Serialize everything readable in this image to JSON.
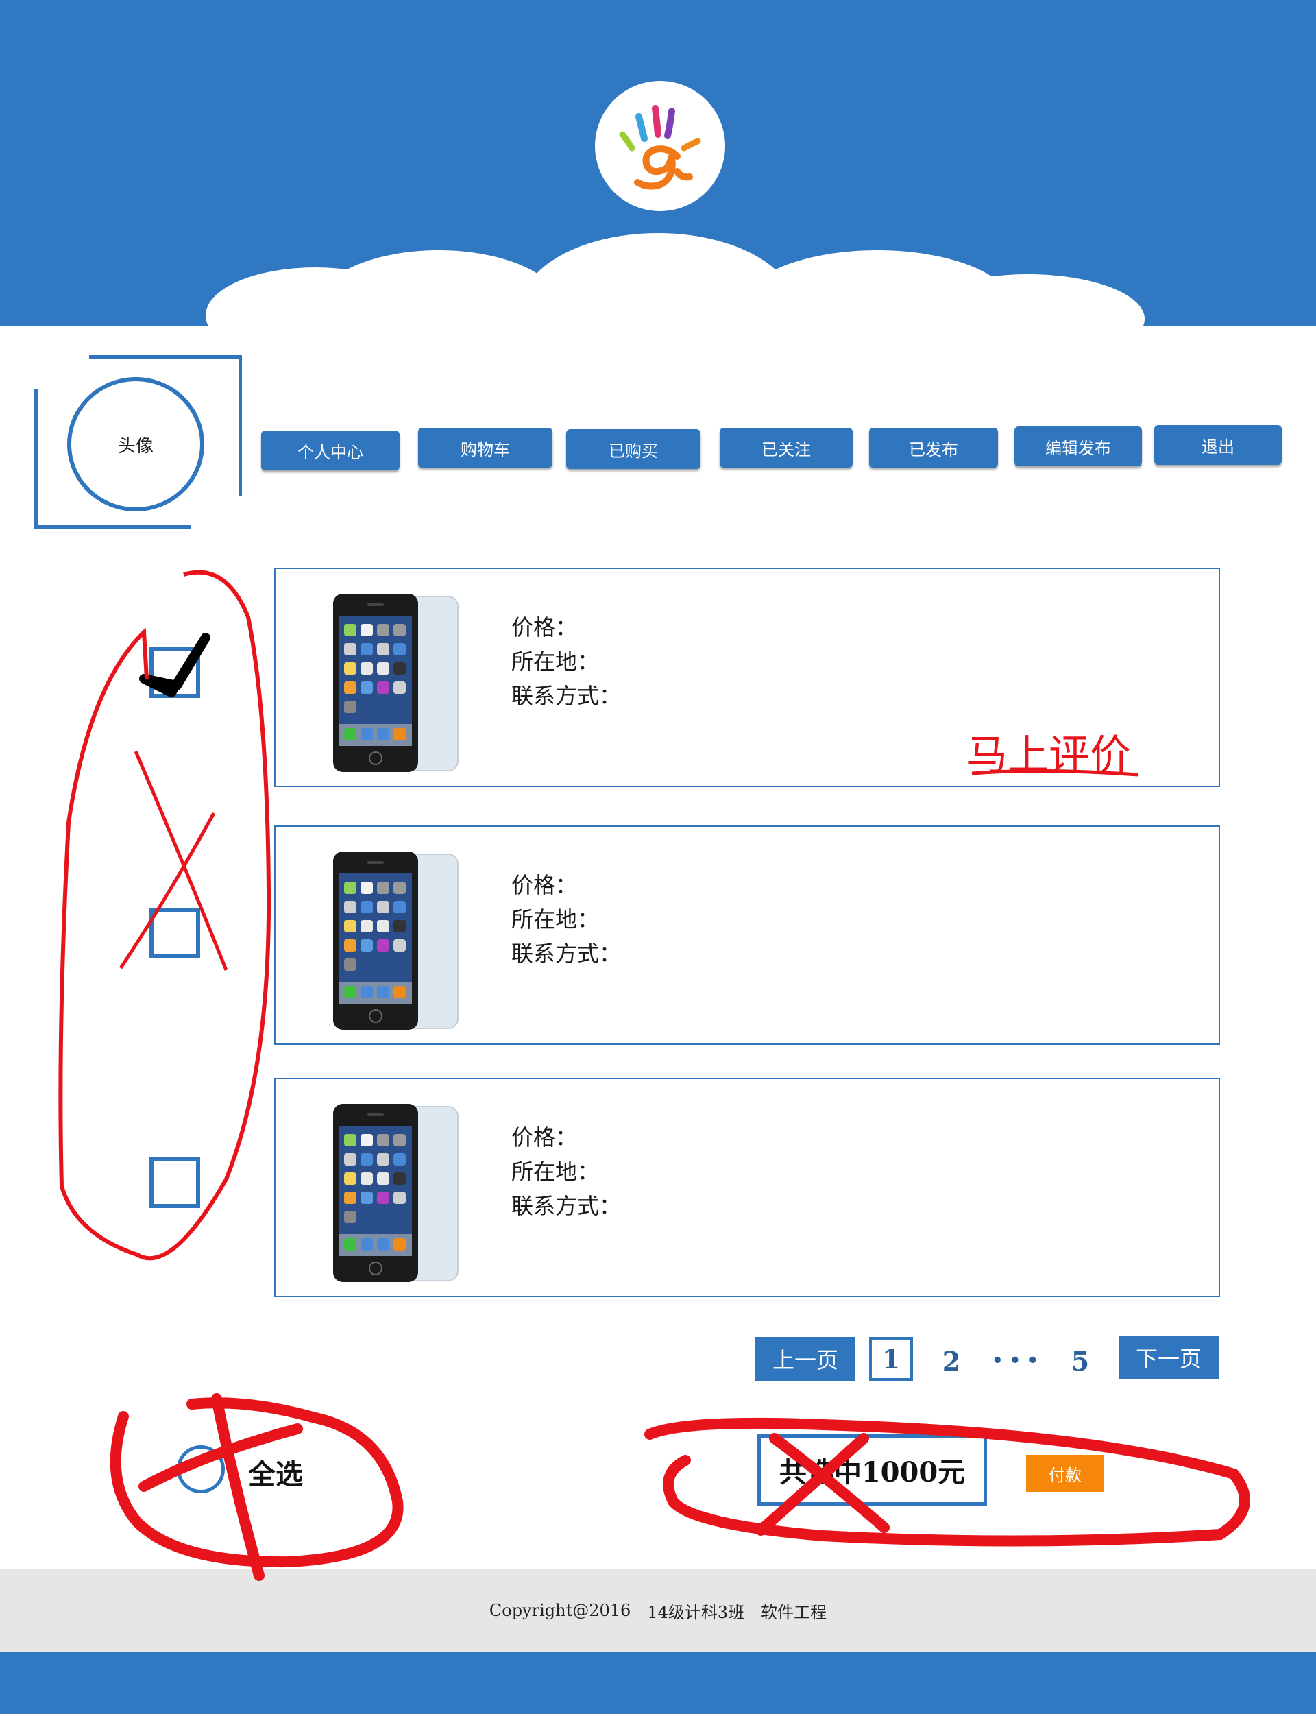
{
  "brand": {
    "logo_icon": "hand-paint-logo-icon"
  },
  "profile": {
    "avatar_label": "头像"
  },
  "nav": {
    "items": [
      {
        "label": "个人中心"
      },
      {
        "label": "购物车"
      },
      {
        "label": "已购买"
      },
      {
        "label": "已关注"
      },
      {
        "label": "已发布"
      },
      {
        "label": "编辑发布"
      },
      {
        "label": "退出"
      }
    ]
  },
  "products": [
    {
      "checked": true,
      "image": "iphone-image",
      "price_label": "价格：",
      "location_label": "所在地：",
      "contact_label": "联系方式："
    },
    {
      "checked": false,
      "image": "iphone-image",
      "price_label": "价格：",
      "location_label": "所在地：",
      "contact_label": "联系方式："
    },
    {
      "checked": false,
      "image": "iphone-image",
      "price_label": "价格：",
      "location_label": "所在地：",
      "contact_label": "联系方式："
    }
  ],
  "pagination": {
    "prev_label": "上一页",
    "current": "1",
    "page_2": "2",
    "ellipsis": "• • •",
    "last": "5",
    "next_label": "下一页"
  },
  "cart": {
    "select_all_label": "全选",
    "total_text": "共选中1000元",
    "pay_label": "付款"
  },
  "annotations": {
    "review_note": "马上评价"
  },
  "footer": {
    "copyright": "Copyright@2016",
    "class_name": "14级计科3班",
    "course": "软件工程"
  },
  "colors": {
    "primary": "#3079c2",
    "accent": "#f7870a",
    "annotation": "#e8141c"
  }
}
